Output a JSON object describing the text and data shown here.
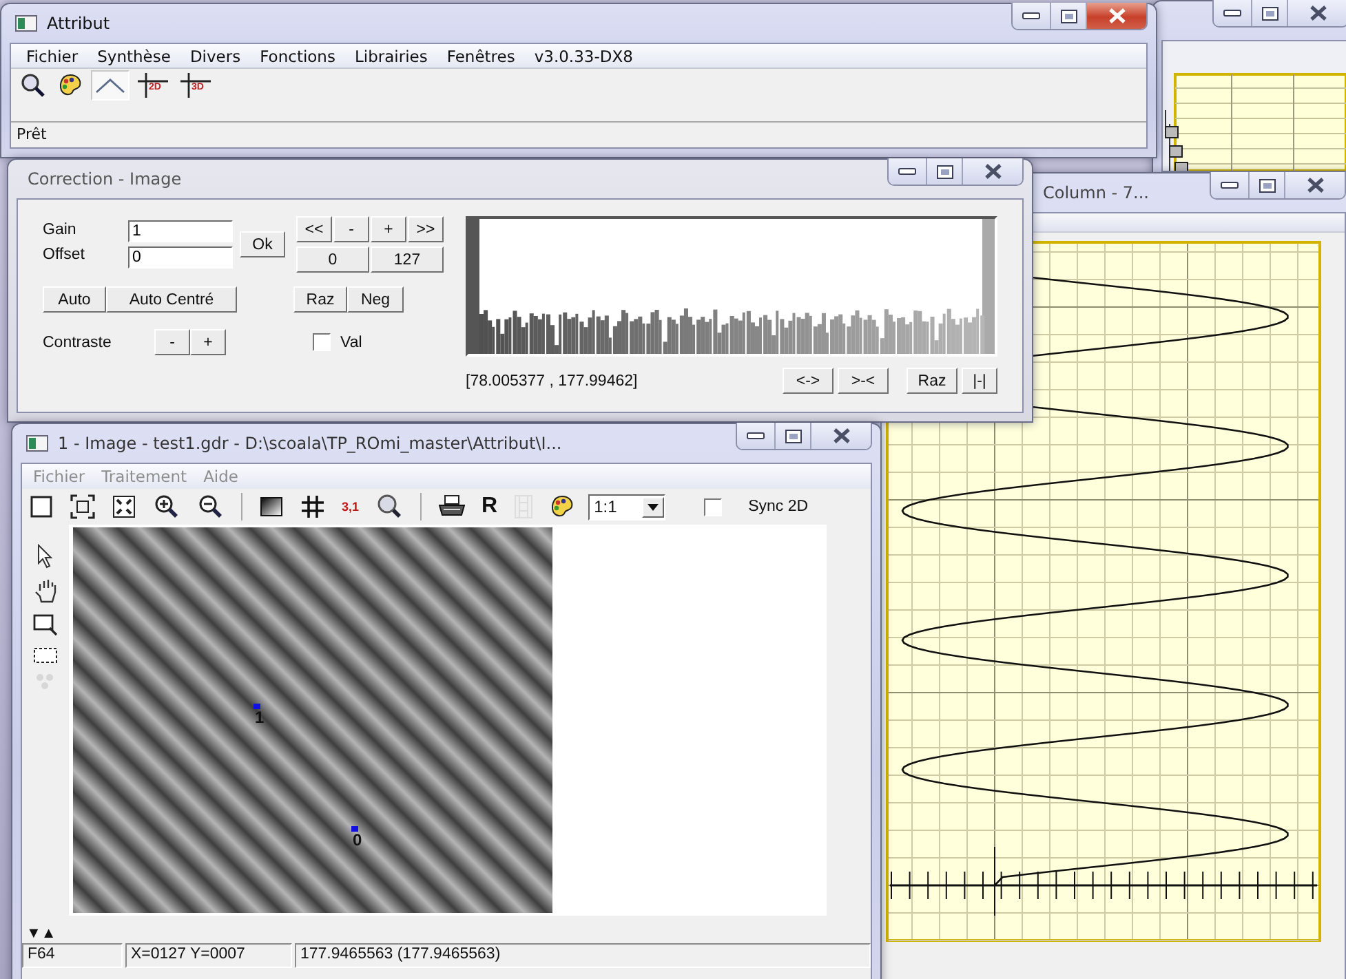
{
  "column_window": {
    "title": "Column - 7..."
  },
  "attribut": {
    "title": "Attribut",
    "active": true,
    "menu": [
      "Fichier",
      "Synthèse",
      "Divers",
      "Fonctions",
      "Librairies",
      "Fenêtres",
      "v3.0.33-DX8"
    ],
    "toolbar": [
      {
        "kind": "zoom",
        "selected": false
      },
      {
        "kind": "palette",
        "selected": false
      },
      {
        "kind": "curve",
        "selected": true
      },
      {
        "kind": "axes",
        "label": "2D",
        "selected": false
      },
      {
        "kind": "axes",
        "label": "3D",
        "selected": false
      }
    ],
    "status": "Prêt"
  },
  "correction": {
    "title": "Correction - Image",
    "gain_label": "Gain",
    "gain_value": "1",
    "offset_label": "Offset",
    "offset_value": "0",
    "ok": "Ok",
    "step_buttons": [
      "<<",
      "-",
      "+",
      ">>"
    ],
    "range_buttons": [
      "0",
      "127"
    ],
    "auto_buttons": [
      "Auto",
      "Auto Centré"
    ],
    "raz_neg": [
      "Raz",
      "Neg"
    ],
    "contrast_label": "Contraste",
    "contrast_buttons": [
      "-",
      "+"
    ],
    "val": {
      "label": "Val",
      "checked": false
    },
    "interval": "[78.005377 , 177.99462]",
    "histogram_buttons": [
      "<->",
      ">-<",
      "Raz",
      "|-|"
    ]
  },
  "image_window": {
    "title": "1 - Image - test1.gdr - D:\\scoala\\TP_ROmi_master\\Attribut\\I...",
    "menu": [
      {
        "label": "Fichier",
        "disabled": true
      },
      {
        "label": "Traitement",
        "disabled": true
      },
      {
        "label": "Aide",
        "disabled": true
      }
    ],
    "toolbar": [
      {
        "kind": "frame",
        "disabled": false
      },
      {
        "kind": "fitwin",
        "disabled": false
      },
      {
        "kind": "fitall",
        "disabled": false
      },
      {
        "kind": "zoomin",
        "disabled": false
      },
      {
        "kind": "zoomout",
        "disabled": false
      },
      {
        "kind": "separator"
      },
      {
        "kind": "gradient",
        "disabled": false
      },
      {
        "kind": "grid",
        "disabled": false
      },
      {
        "kind": "coords",
        "label": "3,1",
        "disabled": false
      },
      {
        "kind": "search",
        "disabled": false
      },
      {
        "kind": "separator"
      },
      {
        "kind": "print",
        "disabled": false
      },
      {
        "kind": "letter",
        "label": "R",
        "disabled": false
      },
      {
        "kind": "film",
        "disabled": true
      },
      {
        "kind": "palette",
        "disabled": false
      }
    ],
    "ratio": "1:1",
    "sync": {
      "label": "Sync 2D",
      "checked": false
    },
    "tools": [
      {
        "kind": "pointer",
        "disabled": false
      },
      {
        "kind": "hand",
        "disabled": false
      },
      {
        "kind": "zoomrect",
        "disabled": false
      },
      {
        "kind": "select",
        "disabled": false
      },
      {
        "kind": "points",
        "disabled": true
      }
    ],
    "markers": [
      {
        "label": "1"
      },
      {
        "label": "0"
      }
    ],
    "nav_arrows": "▼▲",
    "status": [
      "F64",
      "X=0127 Y=0007",
      "177.9465563 (177.9465563)"
    ]
  }
}
